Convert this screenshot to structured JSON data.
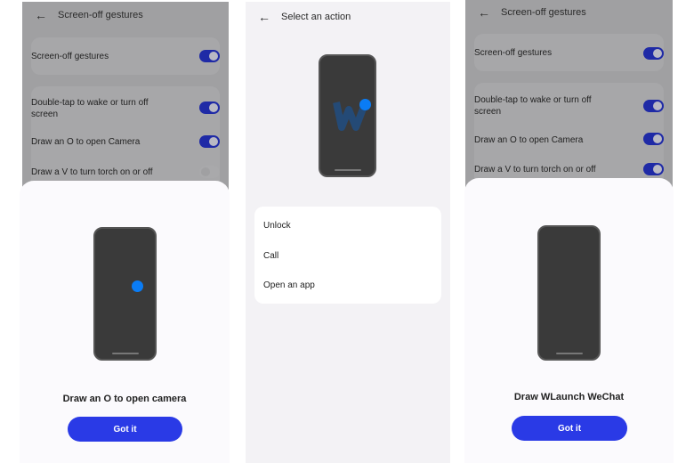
{
  "panels": [
    {
      "header": {
        "title": "Screen-off gestures",
        "back_icon": "arrow-left-icon"
      },
      "settings": [
        {
          "label": "Screen-off gestures",
          "on": true
        },
        {
          "label": "Double-tap to wake or turn off screen",
          "on": true
        },
        {
          "label": "Draw an O to open Camera",
          "on": true
        },
        {
          "label": "Draw a V to turn torch on or off",
          "on": false
        }
      ],
      "sheet": {
        "caption": "Draw an O to open camera",
        "button": "Got it"
      }
    },
    {
      "header": {
        "title": "Select an action",
        "back_icon": "arrow-left-icon"
      },
      "actions": [
        "Unlock",
        "Call",
        "Open an app"
      ]
    },
    {
      "header": {
        "title": "Screen-off gestures",
        "back_icon": "arrow-left-icon"
      },
      "settings": [
        {
          "label": "Screen-off gestures",
          "on": true
        },
        {
          "label": "Double-tap to wake or turn off screen",
          "on": true
        },
        {
          "label": "Draw an O to open Camera",
          "on": true
        },
        {
          "label": "Draw a V to turn torch on or off",
          "on": true
        }
      ],
      "sheet": {
        "caption": "Draw WLaunch  WeChat",
        "button": "Got it"
      }
    }
  ],
  "colors": {
    "accent": "#2a3ae6",
    "toggle_on": "#1f2aa6",
    "gesture_dot": "#0a7cf5"
  }
}
